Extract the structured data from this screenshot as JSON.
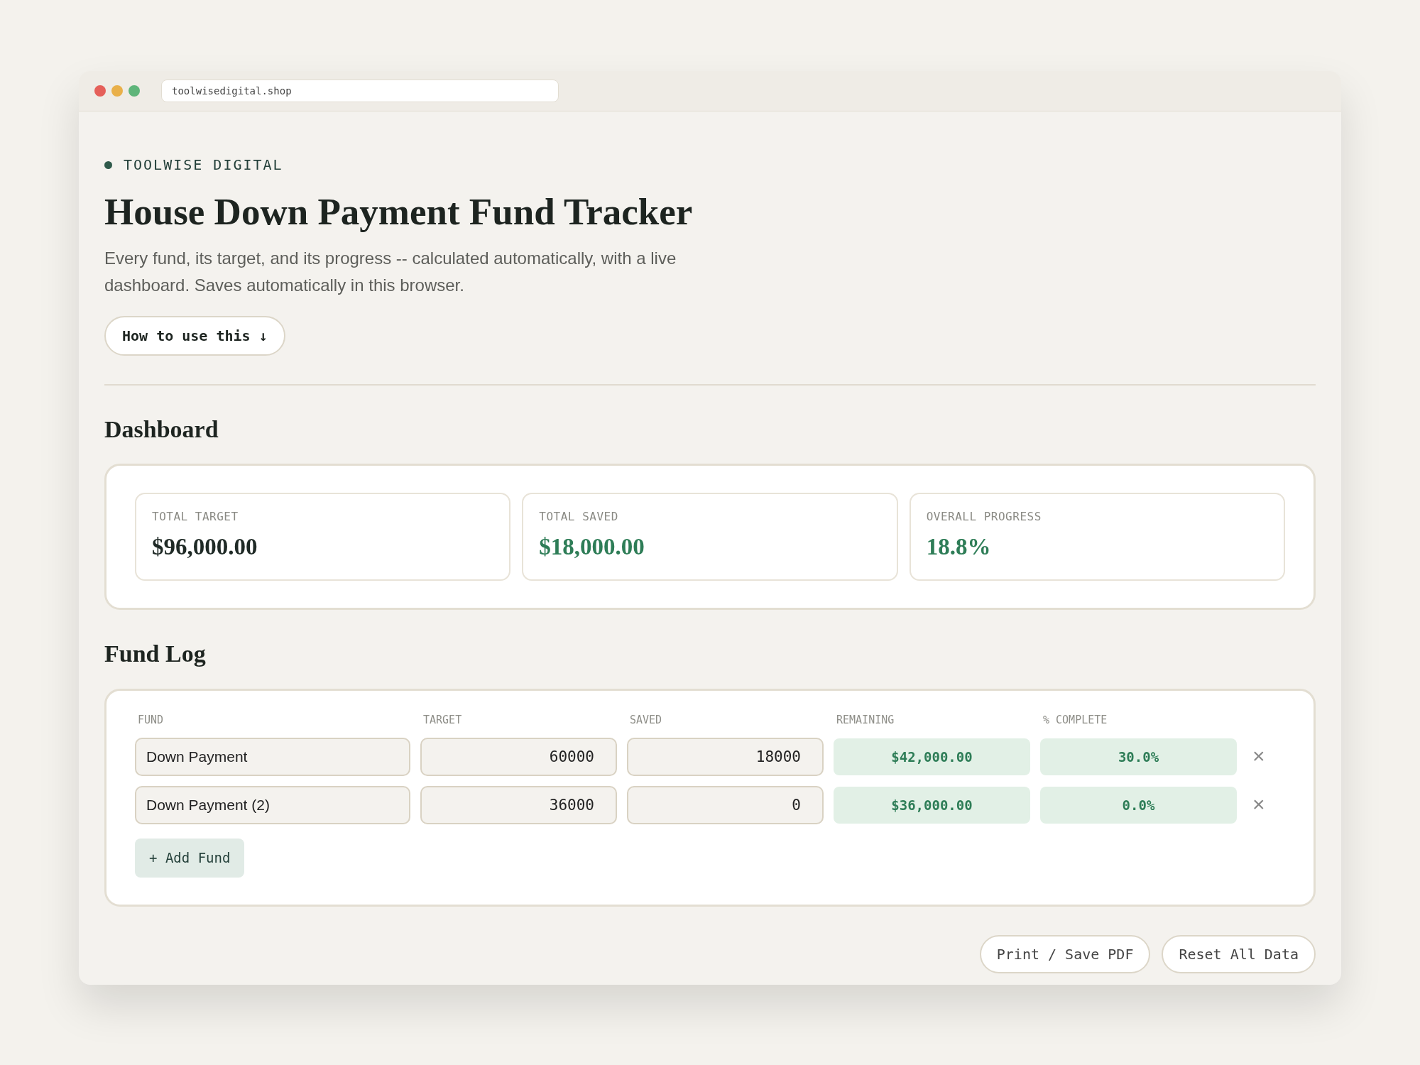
{
  "browser": {
    "url": "toolwisedigital.shop"
  },
  "brand": "TOOLWISE DIGITAL",
  "title": "House Down Payment Fund Tracker",
  "subtitle": "Every fund, its target, and its progress -- calculated automatically, with a live dashboard. Saves automatically in this browser.",
  "how_button": "How to use this ↓",
  "dashboard": {
    "heading": "Dashboard",
    "stats": [
      {
        "label": "TOTAL TARGET",
        "value": "$96,000.00",
        "color": "#1f2a26"
      },
      {
        "label": "TOTAL SAVED",
        "value": "$18,000.00",
        "color": "#2e7d57"
      },
      {
        "label": "OVERALL PROGRESS",
        "value": "18.8%",
        "color": "#2e7d57"
      }
    ]
  },
  "fund_log": {
    "heading": "Fund Log",
    "columns": [
      "FUND",
      "TARGET",
      "SAVED",
      "REMAINING",
      "% COMPLETE"
    ],
    "rows": [
      {
        "fund": "Down Payment",
        "target": "60000",
        "saved": "18000",
        "remaining": "$42,000.00",
        "complete": "30.0%",
        "delete": "×"
      },
      {
        "fund": "Down Payment (2)",
        "target": "36000",
        "saved": "0",
        "remaining": "$36,000.00",
        "complete": "0.0%",
        "delete": "×"
      }
    ],
    "add_button": "+ Add Fund"
  },
  "footer_buttons": [
    "Print / Save PDF",
    "Reset All Data"
  ]
}
